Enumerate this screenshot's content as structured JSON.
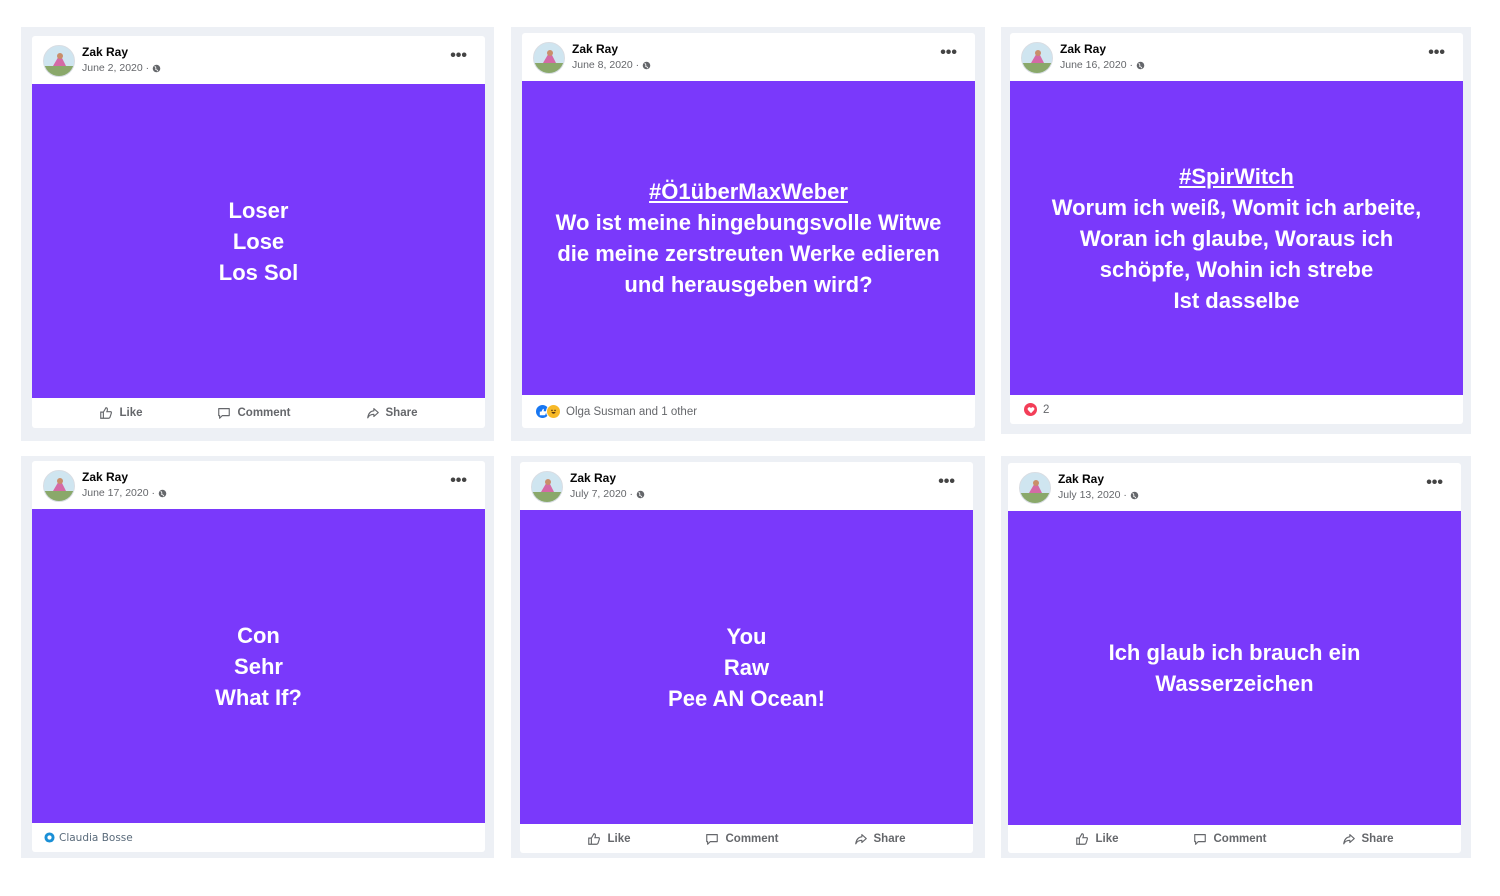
{
  "ui": {
    "like_label": "Like",
    "comment_label": "Comment",
    "share_label": "Share",
    "more_glyph": "•••"
  },
  "posts": [
    {
      "author": "Zak Ray",
      "date": "June 2, 2020 ·",
      "lines": [
        "Loser",
        "Lose",
        "Los Sol"
      ],
      "footer": "actions"
    },
    {
      "author": "Zak Ray",
      "date": "June 8, 2020 ·",
      "hashtag": "#Ö1überMaxWeber",
      "lines": [
        "Wo ist meine hingebungsvolle Witwe",
        "die meine zerstreuten Werke edieren",
        "und herausgeben wird?"
      ],
      "footer": "reactions",
      "reactions_text": "Olga Susman and 1 other"
    },
    {
      "author": "Zak Ray",
      "date": "June 16, 2020 ·",
      "hashtag": "#SpirWitch",
      "lines": [
        "Worum ich weiß, Womit ich arbeite,",
        "Woran ich glaube, Woraus ich",
        "schöpfe, Wohin ich strebe",
        "Ist dasselbe"
      ],
      "footer": "love",
      "love_count": "2"
    },
    {
      "author": "Zak Ray",
      "date": "June 17, 2020 ·",
      "lines": [
        "Con",
        "Sehr",
        "What If?"
      ],
      "footer": "tag",
      "tag_text": "Claudia Bosse"
    },
    {
      "author": "Zak Ray",
      "date": "July 7, 2020 ·",
      "lines": [
        "You",
        "Raw",
        "Pee AN Ocean!"
      ],
      "footer": "actions"
    },
    {
      "author": "Zak Ray",
      "date": "July 13, 2020 ·",
      "lines": [
        "Ich glaub ich brauch ein",
        "Wasserzeichen"
      ],
      "footer": "actions"
    }
  ],
  "colors": {
    "post_background": "#7a39fb",
    "frame": "#edf0f5",
    "like_blue": "#1877f2",
    "love_red": "#f33e58"
  }
}
